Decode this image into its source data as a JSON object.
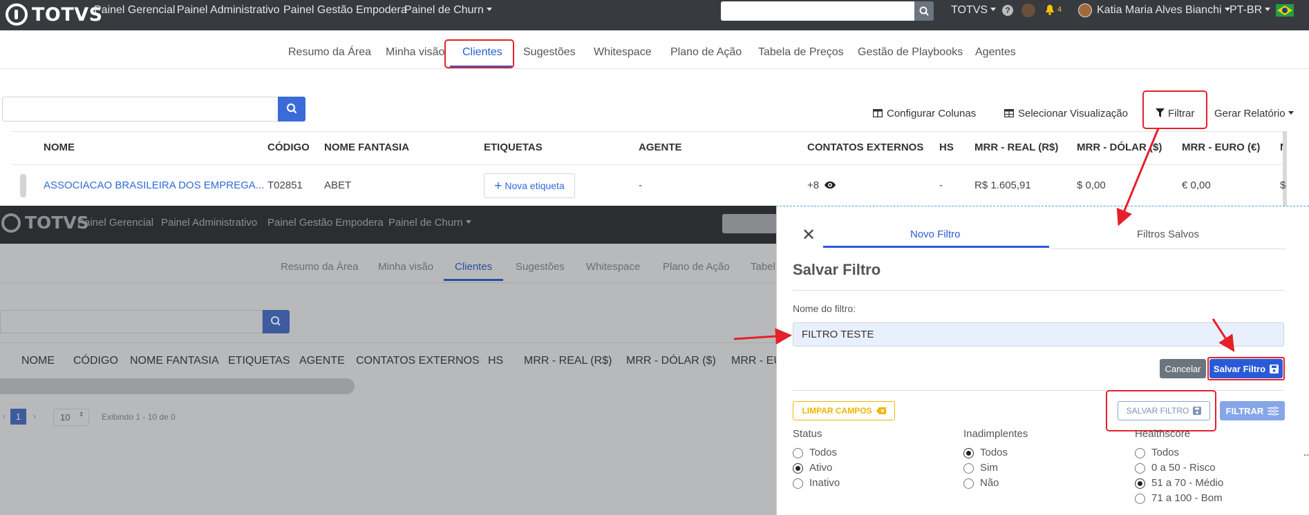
{
  "navbar": {
    "brand": "TOTVS",
    "links": [
      "Painel Gerencial",
      "Painel Administrativo",
      "Painel Gestão Empodera",
      "Painel de Churn"
    ],
    "org_menu": "TOTVS",
    "notif_count": "4",
    "user_name": "Katia Maria Alves Bianchi",
    "lang": "PT-BR",
    "search_value": ""
  },
  "tabs": [
    "Resumo da Área",
    "Minha visão",
    "Clientes",
    "Sugestões",
    "Whitespace",
    "Plano de Ação",
    "Tabela de Preços",
    "Gestão de Playbooks",
    "Agentes"
  ],
  "active_tab": "Clientes",
  "toolbar": {
    "config_cols": "Configurar Colunas",
    "select_view": "Selecionar Visualização",
    "filter": "Filtrar",
    "report": "Gerar Relatório"
  },
  "table": {
    "headers": [
      "NOME",
      "CÓDIGO",
      "NOME FANTASIA",
      "ETIQUETAS",
      "AGENTE",
      "CONTATOS EXTERNOS",
      "HS",
      "MRR - REAL (R$)",
      "MRR - DÓLAR ($)",
      "MRR - EURO (€)",
      "N"
    ],
    "row": {
      "nome": "ASSOCIACAO BRASILEIRA DOS EMPREGA...",
      "codigo": "T02851",
      "fantasia": "ABET",
      "etiqueta_btn": "Nova etiqueta",
      "agente": "-",
      "contatos": "+8",
      "hs": "-",
      "mrr_real": "R$ 1.605,91",
      "mrr_dolar": "$ 0,00",
      "mrr_euro": "€ 0,00",
      "last": "$"
    }
  },
  "background_view": {
    "brand": "TOTVS",
    "links": [
      "Painel Gerencial",
      "Painel Administrativo",
      "Painel Gestão Empodera",
      "Painel de Churn"
    ],
    "tabs": [
      "Resumo da Área",
      "Minha visão",
      "Clientes",
      "Sugestões",
      "Whitespace",
      "Plano de Ação",
      "Tabel"
    ],
    "headers": [
      "NOME",
      "CÓDIGO",
      "NOME FANTASIA",
      "ETIQUETAS",
      "AGENTE",
      "CONTATOS EXTERNOS",
      "HS",
      "MRR - REAL (R$)",
      "MRR - DÓLAR ($)",
      "MRR - EU"
    ],
    "page": "1",
    "page_size": "10",
    "showing": "Exibindo 1 - 10 de 0"
  },
  "filter_panel": {
    "tab_new": "Novo Filtro",
    "tab_saved": "Filtros Salvos",
    "save_title": "Salvar Filtro",
    "name_label": "Nome do filtro:",
    "name_value": "FILTRO TESTE",
    "cancel": "Cancelar",
    "save_btn": "Salvar Filtro",
    "clear": "LIMPAR CAMPOS",
    "save_filter_outline": "SALVAR FILTRO",
    "filter_btn": "FILTRAR",
    "groups": [
      {
        "label": "Status",
        "options": [
          "Todos",
          "Ativo",
          "Inativo"
        ],
        "selected": "Ativo"
      },
      {
        "label": "Inadimplentes",
        "options": [
          "Todos",
          "Sim",
          "Não"
        ],
        "selected": "Todos"
      },
      {
        "label": "Healthscore",
        "options": [
          "Todos",
          "0 a 50 - Risco",
          "51 a 70 - Médio",
          "71 a 100 - Bom"
        ],
        "selected": "51 a 70 - Médio"
      }
    ]
  },
  "colors": {
    "navbar": "#373a3f",
    "accent": "#2a5bd7",
    "annotation": "#e4202b",
    "clear_btn": "#f0b400"
  }
}
